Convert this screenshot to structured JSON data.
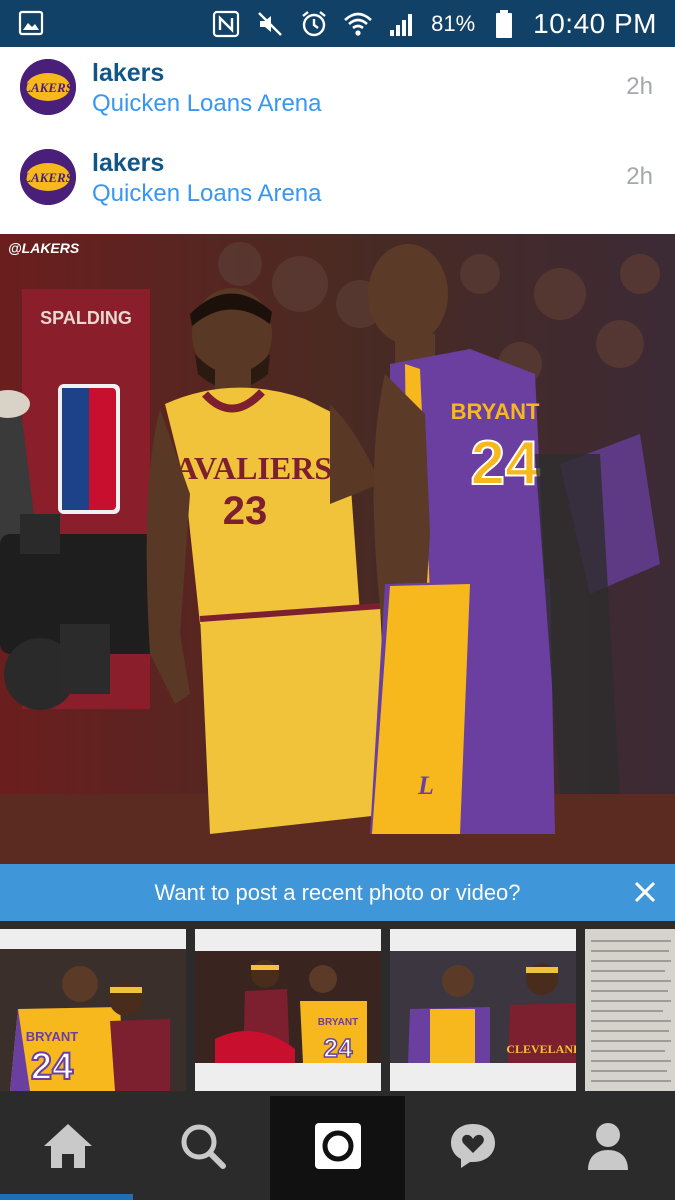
{
  "status_bar": {
    "battery_percent": "81%",
    "time": "10:40 PM",
    "icons": [
      "image-icon",
      "nfc-icon",
      "mute-icon",
      "alarm-icon",
      "wifi-icon",
      "signal-icon",
      "battery-icon"
    ]
  },
  "posts": [
    {
      "username": "lakers",
      "location": "Quicken Loans Arena",
      "time_ago": "2h"
    },
    {
      "username": "lakers",
      "location": "Quicken Loans Arena",
      "time_ago": "2h"
    }
  ],
  "photo": {
    "watermark": "@LAKERS",
    "jersey_left_team": "CAVALIERS",
    "jersey_left_number": "23",
    "jersey_right_name": "BRYANT",
    "jersey_right_number": "24",
    "banner_board": "SPALDING"
  },
  "banner": {
    "text": "Want to post a recent photo or video?"
  },
  "thumbnails": [
    {
      "jersey_name": "BRYANT",
      "jersey_number": "24"
    },
    {
      "jersey_name": "BRYANT",
      "jersey_number": "24"
    },
    {
      "jersey_name": "CLEVELAND",
      "jersey_number": ""
    }
  ],
  "bottom_nav": {
    "items": [
      "home-icon",
      "search-icon",
      "camera-icon",
      "activity-icon",
      "profile-icon"
    ],
    "active": "camera-icon"
  },
  "colors": {
    "status_bar": "#124168",
    "username": "#125688",
    "location": "#3897f0",
    "banner": "#3f96d8",
    "nav_bg": "#2b2b2b",
    "nav_indicator": "#1e6fb7"
  }
}
